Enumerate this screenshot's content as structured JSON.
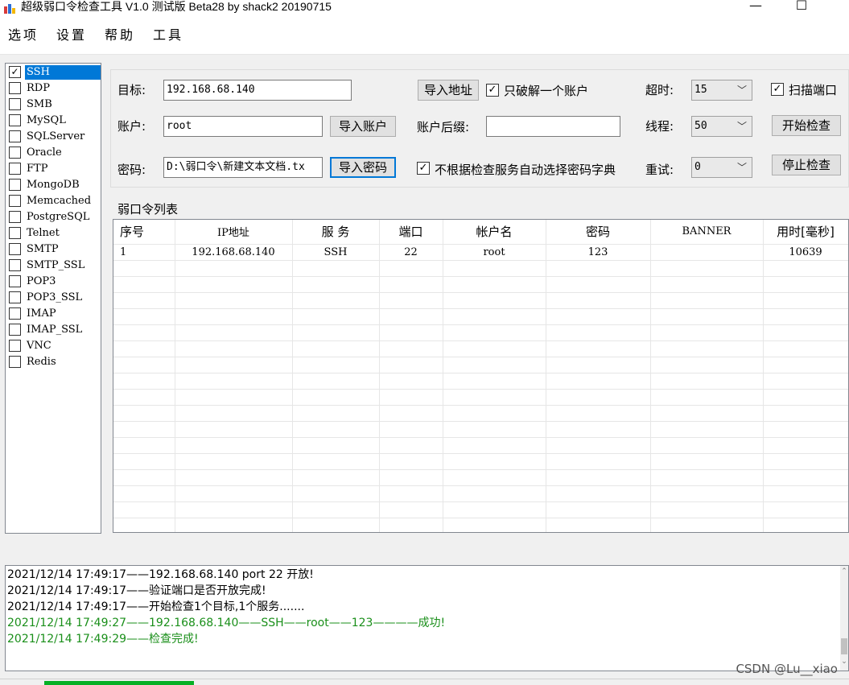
{
  "window": {
    "title": "超级弱口令检查工具 V1.0 测试版 Beta28 by shack2 20190715",
    "minimize": "—",
    "maximize": "☐"
  },
  "menu": [
    "选项",
    "设置",
    "帮助",
    "工具"
  ],
  "services": [
    {
      "label": "SSH",
      "checked": true
    },
    {
      "label": "RDP",
      "checked": false
    },
    {
      "label": "SMB",
      "checked": false
    },
    {
      "label": "MySQL",
      "checked": false
    },
    {
      "label": "SQLServer",
      "checked": false
    },
    {
      "label": "Oracle",
      "checked": false
    },
    {
      "label": "FTP",
      "checked": false
    },
    {
      "label": "MongoDB",
      "checked": false
    },
    {
      "label": "Memcached",
      "checked": false
    },
    {
      "label": "PostgreSQL",
      "checked": false
    },
    {
      "label": "Telnet",
      "checked": false
    },
    {
      "label": "SMTP",
      "checked": false
    },
    {
      "label": "SMTP_SSL",
      "checked": false
    },
    {
      "label": "POP3",
      "checked": false
    },
    {
      "label": "POP3_SSL",
      "checked": false
    },
    {
      "label": "IMAP",
      "checked": false
    },
    {
      "label": "IMAP_SSL",
      "checked": false
    },
    {
      "label": "VNC",
      "checked": false
    },
    {
      "label": "Redis",
      "checked": false
    }
  ],
  "config": {
    "target_label": "目标:",
    "target_value": "192.168.68.140",
    "import_address": "导入地址",
    "only_one_account": "只破解一个账户",
    "timeout_label": "超时:",
    "timeout_value": "15",
    "scan_port": "扫描端口",
    "account_label": "账户:",
    "account_value": "root",
    "import_account": "导入账户",
    "suffix_label": "账户后缀:",
    "suffix_value": "",
    "threads_label": "线程:",
    "threads_value": "50",
    "start_check": "开始检查",
    "password_label": "密码:",
    "password_value": "D:\\弱口令\\新建文本文档.tx",
    "import_password": "导入密码",
    "no_auto_dict": "不根据检查服务自动选择密码字典",
    "retry_label": "重试:",
    "retry_value": "0",
    "stop_check": "停止检查"
  },
  "list_title": "弱口令列表",
  "table": {
    "headers": [
      "序号",
      "IP地址",
      "服 务",
      "端口",
      "帐户名",
      "密码",
      "BANNER",
      "用时[毫秒]"
    ],
    "rows": [
      [
        "1",
        "192.168.68.140",
        "SSH",
        "22",
        "root",
        "123",
        "",
        "10639"
      ]
    ]
  },
  "log": [
    {
      "text": "2021/12/14 17:49:17——192.168.68.140 port 22 开放!",
      "status": "info"
    },
    {
      "text": "2021/12/14 17:49:17——验证端口是否开放完成!",
      "status": "info"
    },
    {
      "text": "2021/12/14 17:49:17——开始检查1个目标,1个服务.......",
      "status": "info"
    },
    {
      "text": "2021/12/14 17:49:27——192.168.68.140——SSH——root——123————成功!",
      "status": "success"
    },
    {
      "text": "2021/12/14 17:49:29——检查完成!",
      "status": "success"
    }
  ],
  "watermark": "CSDN @Lu__xiao",
  "colors": {
    "selection": "#0078d7",
    "success": "#1a8f1a",
    "progress": "#06b025"
  }
}
